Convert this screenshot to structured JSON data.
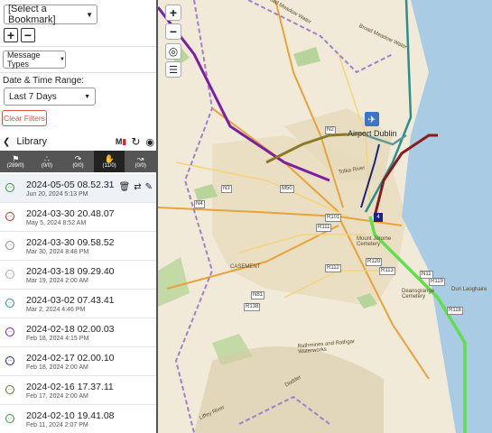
{
  "sidebar": {
    "bookmark_select": "[Select a Bookmark]",
    "plus": "+",
    "minus": "−",
    "message_types": "Message Types",
    "date_range_label": "Date & Time Range:",
    "date_range_value": "Last 7 Days",
    "clear_filters": "Clear Filters"
  },
  "library": {
    "title": "Library",
    "tabs": [
      {
        "icon": "flag-icon",
        "glyph": "⚑",
        "count": "(289/0)"
      },
      {
        "icon": "footsteps-icon",
        "glyph": "∴",
        "count": "(0/0)"
      },
      {
        "icon": "route-icon",
        "glyph": "↷",
        "count": "(0/0)"
      },
      {
        "icon": "hiker-icon",
        "glyph": "✋",
        "count": "(11/0)"
      },
      {
        "icon": "track-icon",
        "glyph": "↝",
        "count": "(0/0)"
      }
    ],
    "items": [
      {
        "title": "2024-05-05 08.52.31",
        "date": "Jun 20, 2024 5:13 PM",
        "color": "#2a9d3a"
      },
      {
        "title": "2024-03-30 20.48.07",
        "date": "May 5, 2024 8:52 AM",
        "color": "#c62828"
      },
      {
        "title": "2024-03-30 09.58.52",
        "date": "Mar 30, 2024 8:48 PM",
        "color": "#888888"
      },
      {
        "title": "2024-03-18 09.29.40",
        "date": "Mar 19, 2024 2:00 AM",
        "color": "#aaaaaa"
      },
      {
        "title": "2024-03-02 07.43.41",
        "date": "Mar 2, 2024 4:46 PM",
        "color": "#2a8f8f"
      },
      {
        "title": "2024-02-18 02.00.03",
        "date": "Feb 18, 2024 4:15 PM",
        "color": "#7b1fa2"
      },
      {
        "title": "2024-02-17 02.00.10",
        "date": "Feb 18, 2024 2:00 AM",
        "color": "#1a237e"
      },
      {
        "title": "2024-02-16 17.37.11",
        "date": "Feb 17, 2024 2:00 AM",
        "color": "#6b6b2a"
      },
      {
        "title": "2024-02-10 19.41.08",
        "date": "Feb 11, 2024 2:07 PM",
        "color": "#2a9d3a"
      }
    ]
  },
  "map": {
    "airport_label": "Airport Dublin",
    "labels": [
      "Broad Meadow Water",
      "Broad Meadow Water",
      "Dun Laoghaire",
      "CASEMENT",
      "Rathmines and Rathgar Waterworks",
      "Liffey River",
      "Mount Jerome Cemetery",
      "Deansgrange Cemetery",
      "Tolka River",
      "Dodder"
    ],
    "roads": [
      "N2",
      "M50",
      "N3",
      "N4",
      "R101",
      "R111",
      "R112",
      "R113",
      "R118",
      "R119",
      "R120",
      "N81",
      "R138",
      "N11"
    ],
    "zoom_in": "+",
    "zoom_out": "−"
  }
}
